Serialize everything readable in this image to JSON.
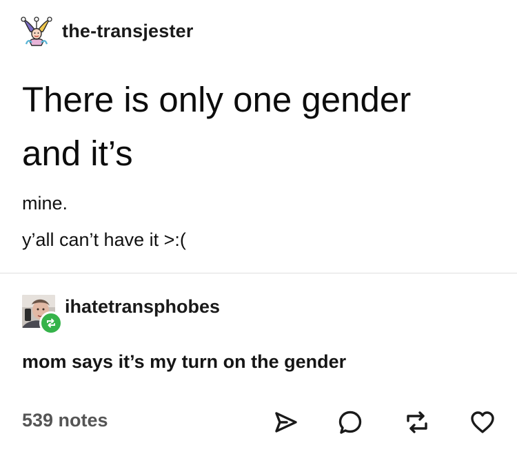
{
  "original_post": {
    "username": "the-transjester",
    "avatar_icon": "jester-hat-avatar",
    "heading_line1": "There is only one gender",
    "heading_line2": "and it’s",
    "body_line1": "mine.",
    "body_line2": "y’all can’t have it >:("
  },
  "reblog": {
    "username": "ihatetransphobes",
    "avatar_icon": "user-photo-avatar",
    "badge_icon": "reblog-icon",
    "badge_color": "#35b34a",
    "text": "mom says it’s my turn on the gender"
  },
  "footer": {
    "notes": "539 notes",
    "actions": [
      {
        "name": "share",
        "icon": "paper-plane-icon"
      },
      {
        "name": "reply",
        "icon": "speech-bubble-icon"
      },
      {
        "name": "reblog",
        "icon": "reblog-icon"
      },
      {
        "name": "like",
        "icon": "heart-icon"
      }
    ],
    "icon_color": "#1a1a1a"
  }
}
